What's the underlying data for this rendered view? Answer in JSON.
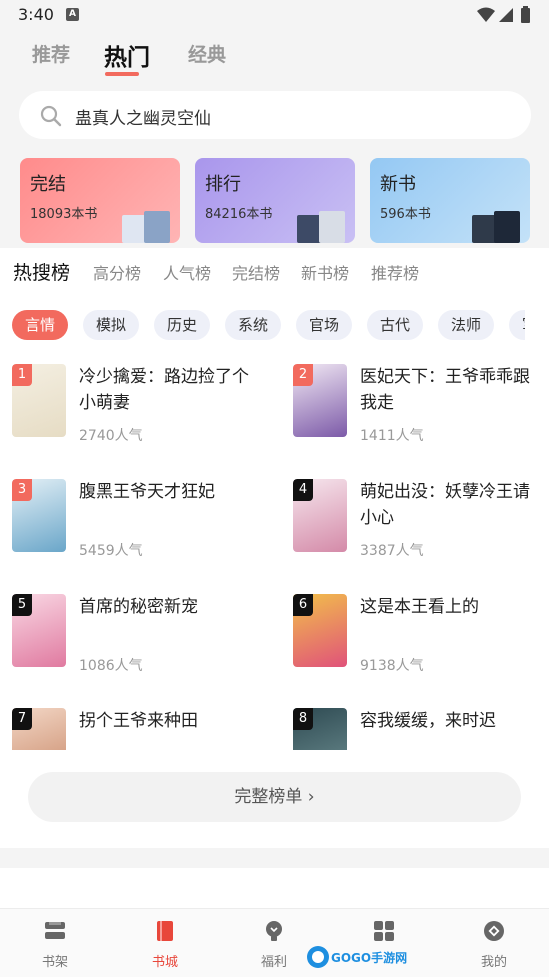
{
  "status": {
    "time": "3:40",
    "notif_badge": "A"
  },
  "tabs": [
    {
      "label": "推荐"
    },
    {
      "label": "热门"
    },
    {
      "label": "经典"
    }
  ],
  "search": {
    "query": "蛊真人之幽灵空仙"
  },
  "cards": [
    {
      "title": "完结",
      "count": "18093本书",
      "color": "#ff8f8f"
    },
    {
      "title": "排行",
      "count": "84216本书",
      "color": "#b3a6ee"
    },
    {
      "title": "新书",
      "count": "596本书",
      "color": "#a6d3f5"
    }
  ],
  "rank_tabs": [
    {
      "label": "热搜榜"
    },
    {
      "label": "高分榜"
    },
    {
      "label": "人气榜"
    },
    {
      "label": "完结榜"
    },
    {
      "label": "新书榜"
    },
    {
      "label": "推荐榜"
    }
  ],
  "chips": [
    {
      "label": "言情"
    },
    {
      "label": "模拟"
    },
    {
      "label": "历史"
    },
    {
      "label": "系统"
    },
    {
      "label": "官场"
    },
    {
      "label": "古代"
    },
    {
      "label": "法师"
    },
    {
      "label": "军"
    }
  ],
  "books": [
    {
      "rank": "1",
      "title": "冷少擒爱：路边捡了个小萌妻",
      "popularity": "2740人气",
      "rank_color": "#f26a5e"
    },
    {
      "rank": "2",
      "title": "医妃天下：王爷乖乖跟我走",
      "popularity": "1411人气",
      "rank_color": "#f26a5e"
    },
    {
      "rank": "3",
      "title": "腹黑王爷天才狂妃",
      "popularity": "5459人气",
      "rank_color": "#f26a5e"
    },
    {
      "rank": "4",
      "title": "萌妃出没：妖孽冷王请小心",
      "popularity": "3387人气",
      "rank_color": "#111111"
    },
    {
      "rank": "5",
      "title": "首席的秘密新宠",
      "popularity": "1086人气",
      "rank_color": "#111111"
    },
    {
      "rank": "6",
      "title": "这是本王看上的",
      "popularity": "9138人气",
      "rank_color": "#111111"
    },
    {
      "rank": "7",
      "title": "拐个王爷来种田",
      "popularity": "",
      "rank_color": "#111111"
    },
    {
      "rank": "8",
      "title": "容我缓缓，来时迟",
      "popularity": "",
      "rank_color": "#111111"
    }
  ],
  "full_list_button": "完整榜单 ›",
  "nav": [
    {
      "label": "书架",
      "icon": "bookshelf-icon"
    },
    {
      "label": "书城",
      "icon": "book-icon"
    },
    {
      "label": "福利",
      "icon": "bulb-icon"
    },
    {
      "label": "",
      "icon": "grid-icon"
    },
    {
      "label": "我的",
      "icon": "profile-icon"
    }
  ],
  "watermark": "GOGO手游网",
  "colors": {
    "accent": "#f26a5e",
    "active_nav": "#e8473b"
  }
}
